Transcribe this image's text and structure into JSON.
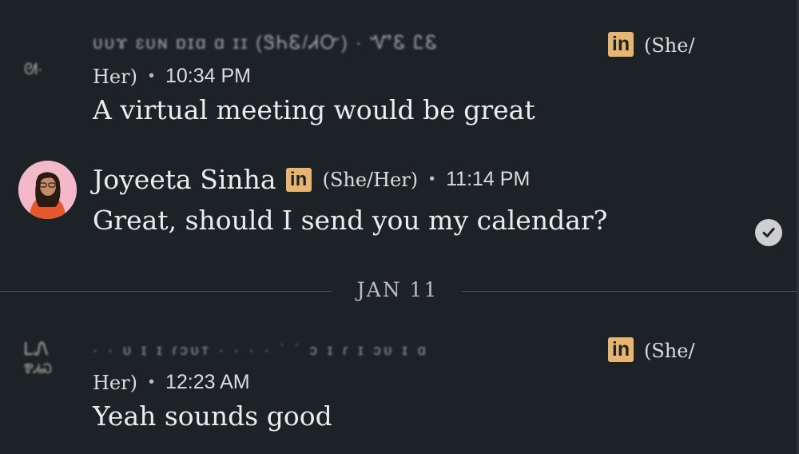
{
  "messages": [
    {
      "sender_name": "ᴜᴜɤ ɛᴜɴ ɒɪɑ ɑ ɪɪ (ᏕᏂᏋ/ᏗᏅ) · ᏉᏋ ᏝᏋ",
      "pronouns_line1": "(She/",
      "pronouns_line2": "Her)",
      "time": "10:34 PM",
      "text": "A virtual meeting would be great",
      "avatar_glyph": "ᘛ·"
    },
    {
      "sender_name": "Joyeeta Sinha",
      "pronouns": "(She/Her)",
      "time": "11:14 PM",
      "text": "Great, should I send you my calendar?",
      "read_icon": "check-circle-icon"
    },
    {
      "sender_name": "· · ᴜ ɪ ɪ ɾɔᴜᴛ · · · · ʾ ʿ ɔ ɪ ɾ ɪ ɔᴜ ɪ ɑ",
      "pronouns_line1": "(She/",
      "pronouns_line2": "Her)",
      "time": "12:23 AM",
      "text": "Yeah sounds good",
      "avatar_glyph_top": "ᏞᏁ",
      "avatar_glyph_bottom": "ᏈᏗᏍ"
    }
  ],
  "date_separator": "JAN 11",
  "linkedin_badge": "in",
  "separator_dot": "•",
  "colors": {
    "background": "#1d2226",
    "badge": "#e7b56f",
    "text": "#ececec",
    "divider": "#4a4f54"
  }
}
